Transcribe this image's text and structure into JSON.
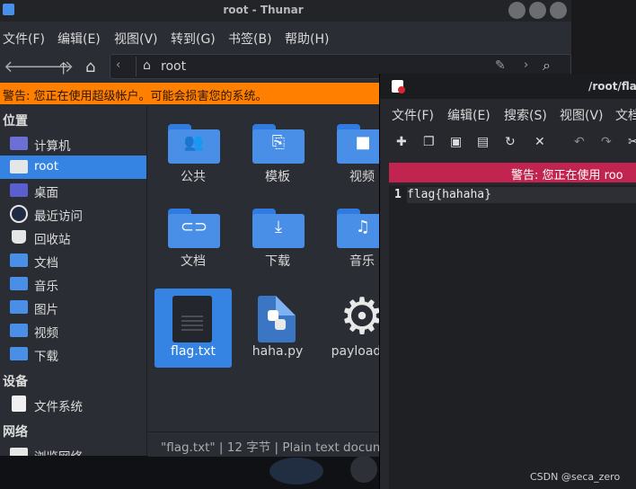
{
  "thunar": {
    "title": "root - Thunar",
    "menu": [
      "文件(F)",
      "编辑(E)",
      "视图(V)",
      "转到(G)",
      "书签(B)",
      "帮助(H)"
    ],
    "path": {
      "current": "root"
    },
    "warning": "警告: 您正在使用超级帐户。可能会损害您的系统。",
    "sidebar": {
      "section_places": "位置",
      "places": [
        {
          "label": "计算机",
          "icon": "computer-icon",
          "color": "#6b6fd6"
        },
        {
          "label": "root",
          "icon": "home-folder-icon",
          "color": "#e6e6e6"
        },
        {
          "label": "桌面",
          "icon": "desktop-icon",
          "color": "#5a5fcf"
        },
        {
          "label": "最近访问",
          "icon": "recent-icon",
          "color": "#3a6fd0"
        },
        {
          "label": "回收站",
          "icon": "trash-icon",
          "color": "#e6e6e6"
        },
        {
          "label": "文档",
          "icon": "documents-folder-icon",
          "color": "#4a8fe7"
        },
        {
          "label": "音乐",
          "icon": "music-folder-icon",
          "color": "#4a8fe7"
        },
        {
          "label": "图片",
          "icon": "pictures-folder-icon",
          "color": "#4a8fe7"
        },
        {
          "label": "视频",
          "icon": "videos-folder-icon",
          "color": "#4a8fe7"
        },
        {
          "label": "下载",
          "icon": "downloads-folder-icon",
          "color": "#4a8fe7"
        }
      ],
      "section_devices": "设备",
      "devices": [
        {
          "label": "文件系统",
          "icon": "filesystem-icon"
        }
      ],
      "section_network": "网络",
      "network": [
        {
          "label": "浏览网络",
          "icon": "network-icon"
        }
      ]
    },
    "items": [
      {
        "name": "公共",
        "glyph": "👥"
      },
      {
        "name": "模板",
        "glyph": "⎘"
      },
      {
        "name": "视频",
        "glyph": "■"
      },
      {
        "name": "文档",
        "glyph": "⊂⊃"
      },
      {
        "name": "下载",
        "glyph": "⤓"
      },
      {
        "name": "音乐",
        "glyph": "♫"
      },
      {
        "name": "flag.txt"
      },
      {
        "name": "haha.py"
      },
      {
        "name": "payload.e"
      }
    ],
    "status": "\"flag.txt\" | 12 字节 | Plain text docum"
  },
  "editor": {
    "title": "/root/flag",
    "menu": [
      "文件(F)",
      "编辑(E)",
      "搜索(S)",
      "视图(V)",
      "文档"
    ],
    "warning": "警告: 您正在使用 roo",
    "line_number": "1",
    "content": "flag{hahaha}"
  },
  "watermark": "CSDN @seca_zero",
  "colors": {
    "accent": "#3584e4",
    "warning_orange": "#ff7f00",
    "warning_red": "#c0244f",
    "folder_blue": "#4a8fe7"
  }
}
